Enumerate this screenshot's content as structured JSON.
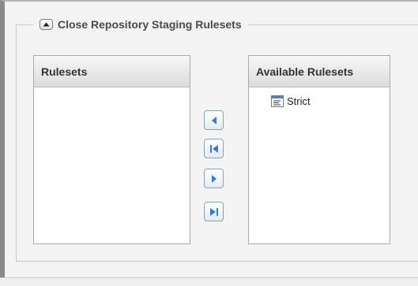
{
  "section": {
    "title": "Close Repository Staging Rulesets",
    "collapse_icon": "collapse-up-icon"
  },
  "left_panel": {
    "header": "Rulesets",
    "items": []
  },
  "right_panel": {
    "header": "Available Rulesets",
    "items": [
      {
        "label": "Strict",
        "icon": "ruleset-icon"
      }
    ]
  },
  "transfer_buttons": [
    {
      "name": "move-left",
      "icon": "arrow-left-icon"
    },
    {
      "name": "move-all-left",
      "icon": "arrow-first-icon"
    },
    {
      "name": "move-right",
      "icon": "arrow-right-icon"
    },
    {
      "name": "move-all-right",
      "icon": "arrow-last-icon"
    }
  ],
  "colors": {
    "button_icon": "#2f7fd8",
    "header_bg": "#dcdcdc",
    "border": "#a9a9a9"
  }
}
